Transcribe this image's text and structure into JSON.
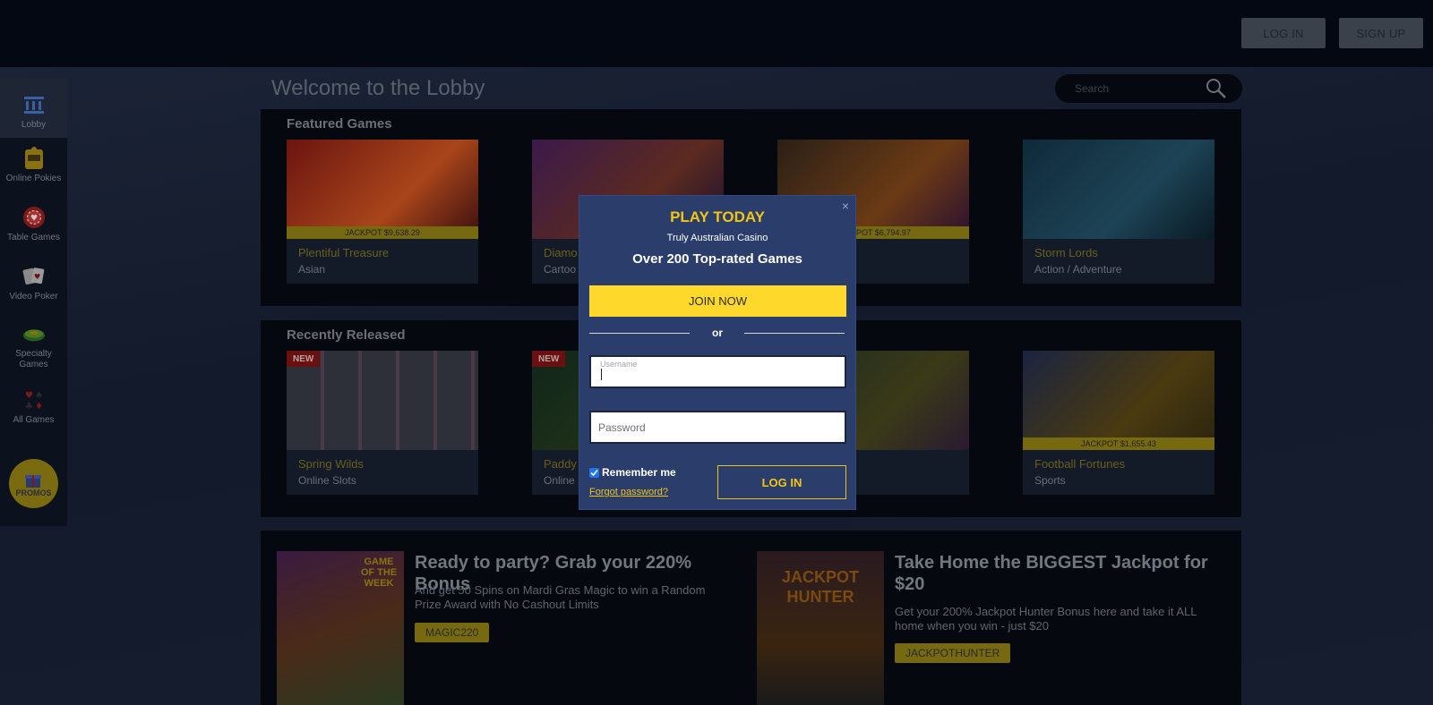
{
  "header": {
    "login_label": "LOG IN",
    "signup_label": "SIGN UP"
  },
  "sidebar": {
    "items": [
      {
        "label": "Lobby",
        "icon": "lobby-icon"
      },
      {
        "label": "Online Pokies",
        "icon": "slot-machine-icon"
      },
      {
        "label": "Table Games",
        "icon": "poker-chip-icon"
      },
      {
        "label": "Video Poker",
        "icon": "cards-icon"
      },
      {
        "label": "Specialty Games",
        "icon": "roulette-icon"
      },
      {
        "label": "All Games",
        "icon": "card-suits-icon"
      }
    ],
    "promos_label": "PROMOS"
  },
  "lobby": {
    "title": "Welcome to the Lobby",
    "search_placeholder": "Search"
  },
  "featured": {
    "title": "Featured Games",
    "games": [
      {
        "name": "Plentiful Treasure",
        "category": "Asian",
        "jackpot": "JACKPOT $9,638.29",
        "color1": "#6b1510",
        "color2": "#a8451a"
      },
      {
        "name": "Diamo",
        "category": "Cartoo",
        "jackpot": "",
        "color1": "#3a1a4a",
        "color2": "#5c2a20"
      },
      {
        "name": "easures",
        "category": "",
        "jackpot": "JACKPOT $6,794.97",
        "color1": "#2a2016",
        "color2": "#6b3a15"
      },
      {
        "name": "Storm Lords",
        "category": "Action / Adventure",
        "jackpot": "",
        "color1": "#0f2a3a",
        "color2": "#1d4456"
      }
    ]
  },
  "recent": {
    "title": "Recently Released",
    "games": [
      {
        "name": "Spring Wilds",
        "category": "Online Slots",
        "badge": "NEW",
        "jackpot": "",
        "color1": "#2d3038",
        "color2": "#4a3a48"
      },
      {
        "name": "Paddy",
        "category": "Online S",
        "badge": "NEW",
        "jackpot": "",
        "color1": "#10261a",
        "color2": "#2a3a16"
      },
      {
        "name": "agic",
        "category": "",
        "badge": "",
        "jackpot": "",
        "color1": "#1e2a20",
        "color2": "#3a3a18"
      },
      {
        "name": "Football Fortunes",
        "category": "Sports",
        "badge": "",
        "jackpot": "JACKPOT $1,655.43",
        "color1": "#2a2410",
        "color2": "#4a3a10"
      }
    ]
  },
  "promos": [
    {
      "title": "Ready to party? Grab your 220% Bonus",
      "text": "And get 50 Spins on Mardi Gras Magic to win a Random Prize Award with No Cashout Limits",
      "code": "MAGIC220",
      "image_label": "GAME OF THE WEEK"
    },
    {
      "title": "Take Home the BIGGEST Jackpot for $20",
      "text": "Get your 200% Jackpot Hunter Bonus here and take it ALL home when you win - just $20",
      "code": "JACKPOTHUNTER",
      "image_label": "JACKPOT HUNTER"
    }
  ],
  "modal": {
    "close": "×",
    "title": "PLAY TODAY",
    "subtitle": "Truly Australian Casino",
    "heading": "Over 200 Top-rated Games",
    "join_label": "JOIN NOW",
    "or_label": "or",
    "username_label": "Username",
    "username_value": "",
    "password_placeholder": "Password",
    "remember_label": "Remember me",
    "remember_checked": true,
    "forgot_label": "Forgot password?",
    "login_label": "LOG IN"
  },
  "colors": {
    "accent_yellow": "#fed82b",
    "modal_bg": "#2a3d6b",
    "page_bg": "#141b2c"
  }
}
